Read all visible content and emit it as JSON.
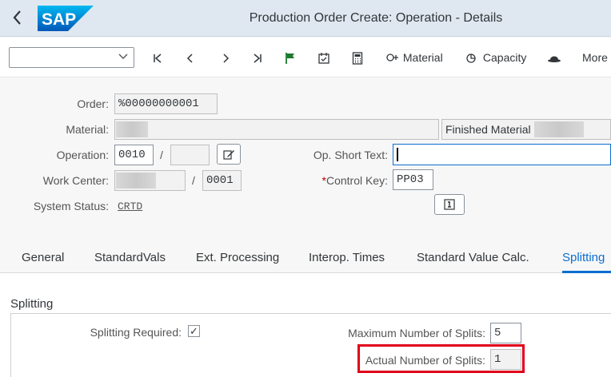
{
  "shell": {
    "title": "Production Order Create: Operation - Details",
    "logo_text": "SAP"
  },
  "toolbar": {
    "select_value": "",
    "first_label": "|<",
    "prev_label": "<",
    "next_label": ">",
    "last_label": ">|",
    "material_label": "Material",
    "capacity_label": "Capacity",
    "more_label": "More"
  },
  "form": {
    "order_label": "Order:",
    "order_value": "%00000000001",
    "material_label": "Material:",
    "material_desc": "Finished Material",
    "operation_label": "Operation:",
    "operation_value": "0010",
    "operation_slash": "/",
    "op_short_text_label": "Op. Short Text:",
    "work_center_label": "Work Center:",
    "work_center_slash": "/",
    "work_center_plant": "0001",
    "control_key_label": "Control Key:",
    "control_key_required": "*",
    "control_key_value": "PP03",
    "system_status_label": "System Status:",
    "system_status_value": "CRTD"
  },
  "tabs": [
    {
      "label": "General"
    },
    {
      "label": "StandardVals"
    },
    {
      "label": "Ext. Processing"
    },
    {
      "label": "Interop. Times"
    },
    {
      "label": "Standard Value Calc."
    },
    {
      "label": "Splitting"
    }
  ],
  "splitting": {
    "section_title": "Splitting",
    "required_label": "Splitting Required:",
    "required_checked": "✓",
    "max_label": "Maximum Number of Splits:",
    "max_value": "5",
    "actual_label": "Actual Number of Splits:",
    "actual_value": "1"
  },
  "colors": {
    "accent": "#0a6ed1",
    "highlight": "#e0001b",
    "shell_bg": "#dfe8f0"
  }
}
